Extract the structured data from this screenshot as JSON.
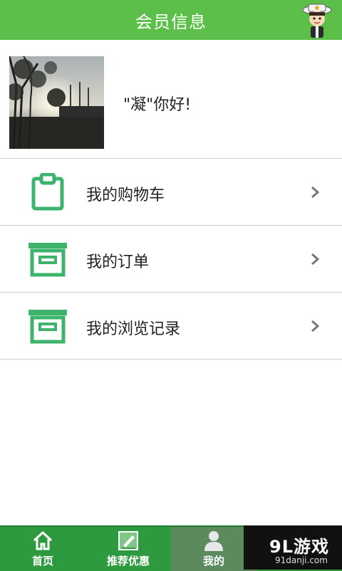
{
  "header": {
    "title": "会员信息",
    "mascot_icon": "mascot-icon"
  },
  "profile": {
    "greeting": "\"凝\"你好!"
  },
  "menu": [
    {
      "label": "我的购物车",
      "icon": "clipboard-icon"
    },
    {
      "label": "我的订单",
      "icon": "archive-box-icon"
    },
    {
      "label": "我的浏览记录",
      "icon": "archive-box-icon"
    }
  ],
  "tabs": [
    {
      "label": "首页",
      "icon": "home-icon"
    },
    {
      "label": "推荐优惠",
      "icon": "recommend-icon"
    },
    {
      "label": "我的",
      "icon": "user-icon"
    }
  ],
  "watermark": {
    "logo": "9L游戏",
    "url": "91danji.com"
  },
  "colors": {
    "header": "#5cbf4a",
    "icon_green": "#3db36b",
    "tabbar": "#2e9a40"
  }
}
